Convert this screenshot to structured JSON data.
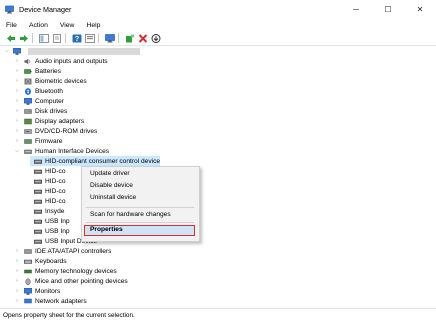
{
  "window": {
    "title": "Device Manager",
    "controls": {
      "minimize": "─",
      "maximize": "☐",
      "close": "✕"
    }
  },
  "menubar": [
    "File",
    "Action",
    "View",
    "Help"
  ],
  "toolbar": {
    "buttons": [
      "back-arrow-icon",
      "forward-arrow-icon",
      "show-hide-tree-icon",
      "properties-sheet-icon",
      "help-icon",
      "refresh-view-icon",
      "monitor-icon",
      "add-driver-icon",
      "uninstall-x-icon",
      "download-icon"
    ],
    "colors": {
      "green": "#2e9e3e",
      "red": "#d32f2f",
      "blue": "#2a6fb5"
    }
  },
  "tree": {
    "categories": [
      {
        "label": "Audio inputs and outputs",
        "icon": "speaker-icon"
      },
      {
        "label": "Batteries",
        "icon": "battery-icon"
      },
      {
        "label": "Biometric devices",
        "icon": "biometric-icon"
      },
      {
        "label": "Bluetooth",
        "icon": "bluetooth-icon"
      },
      {
        "label": "Computer",
        "icon": "computer-icon"
      },
      {
        "label": "Disk drives",
        "icon": "disk-icon"
      },
      {
        "label": "Display adapters",
        "icon": "display-icon"
      },
      {
        "label": "DVD/CD-ROM drives",
        "icon": "dvd-icon"
      },
      {
        "label": "Firmware",
        "icon": "firmware-icon"
      },
      {
        "label": "Human Interface Devices",
        "icon": "hid-icon",
        "expanded": true
      }
    ],
    "hid_children": [
      {
        "label": "HID-compliant consumer control device",
        "selected": true
      },
      {
        "label": "HID-co"
      },
      {
        "label": "HID-co"
      },
      {
        "label": "HID-co"
      },
      {
        "label": "HID-co"
      },
      {
        "label": "Insyde"
      },
      {
        "label": "USB Inp"
      },
      {
        "label": "USB Inp"
      },
      {
        "label": "USB Input Device"
      }
    ],
    "categories_after": [
      {
        "label": "IDE ATA/ATAPI controllers",
        "icon": "ide-icon"
      },
      {
        "label": "Keyboards",
        "icon": "keyboard-icon"
      },
      {
        "label": "Memory technology devices",
        "icon": "memory-icon"
      },
      {
        "label": "Mice and other pointing devices",
        "icon": "mouse-icon"
      },
      {
        "label": "Monitors",
        "icon": "monitor-icon"
      },
      {
        "label": "Network adapters",
        "icon": "network-icon"
      }
    ]
  },
  "context_menu": {
    "items": [
      "Update driver",
      "Disable device",
      "Uninstall device",
      "Scan for hardware changes",
      "Properties"
    ],
    "highlighted": "Properties",
    "highlight_border": "#d32f2f"
  },
  "statusbar": {
    "text": "Opens property sheet for the current selection."
  }
}
